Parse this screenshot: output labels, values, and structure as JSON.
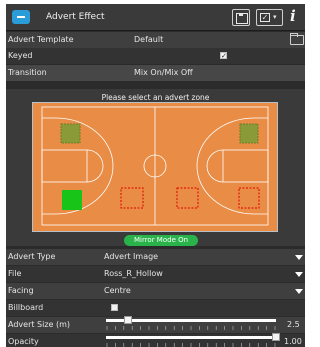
{
  "window": {
    "title": "Advert Effect",
    "icons": {
      "app": "advert-icon",
      "save": "save-icon",
      "check": "check-dropdown-icon",
      "info": "info-icon"
    },
    "info_glyph": "i"
  },
  "properties": {
    "advert_template": {
      "label": "Advert Template",
      "value": "Default"
    },
    "keyed": {
      "label": "Keyed",
      "checked": true
    },
    "transition": {
      "label": "Transition",
      "value": "Mix On/Mix Off"
    }
  },
  "zone_selector": {
    "prompt": "Please select an advert zone",
    "mirror_button": "Mirror Mode On",
    "colors": {
      "court": "#e98c45",
      "lines": "#ffffff",
      "border": "#b9c0c8",
      "selected_zone": "#18c418",
      "olive_zone": "#8a9a38",
      "unselected_zone_border": "#e00000",
      "mirror_button": "#29b34a"
    },
    "zones": [
      {
        "name": "left-top",
        "state": "available"
      },
      {
        "name": "right-top",
        "state": "available"
      },
      {
        "name": "left-bottom",
        "state": "selected"
      },
      {
        "name": "center-left",
        "state": "inactive"
      },
      {
        "name": "center-right",
        "state": "inactive"
      },
      {
        "name": "right-bottom",
        "state": "inactive"
      }
    ]
  },
  "advert": {
    "type": {
      "label": "Advert Type",
      "value": "Advert Image"
    },
    "file": {
      "label": "File",
      "value": "Ross_R_Hollow"
    },
    "facing": {
      "label": "Facing",
      "value": "Centre"
    },
    "billboard": {
      "label": "Billboard",
      "checked": false
    },
    "size": {
      "label": "Advert Size (m)",
      "value": "2.5",
      "level": 0.13
    },
    "opacity": {
      "label": "Opacity",
      "value": "1.00",
      "level": 1.0
    }
  },
  "theme": {
    "panel": "#2b2b2b",
    "row_light": "#3f3f3f",
    "row_dark": "#333333",
    "accent": "#2a9cd8"
  }
}
